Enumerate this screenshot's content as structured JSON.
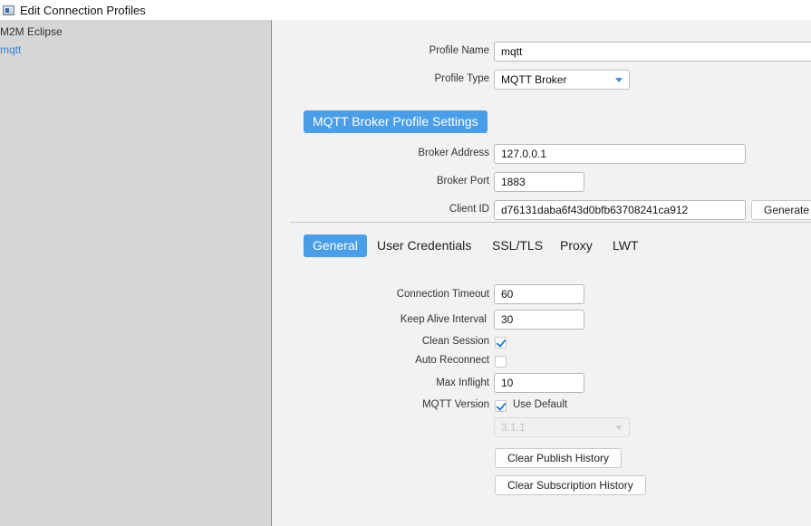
{
  "window": {
    "title": "Edit Connection Profiles"
  },
  "sidebar": {
    "root": "M2M Eclipse",
    "items": [
      {
        "label": "mqtt"
      }
    ]
  },
  "profile": {
    "name_label": "Profile Name",
    "name_value": "mqtt",
    "type_label": "Profile Type",
    "type_value": "MQTT Broker"
  },
  "broker": {
    "section_title": "MQTT Broker Profile Settings",
    "address_label": "Broker Address",
    "address_value": "127.0.0.1",
    "port_label": "Broker Port",
    "port_value": "1883",
    "client_id_label": "Client ID",
    "client_id_value": "d76131daba6f43d0bfb63708241ca912",
    "generate_label": "Generate"
  },
  "tabs": [
    {
      "label": "General",
      "active": true
    },
    {
      "label": "User Credentials",
      "active": false
    },
    {
      "label": "SSL/TLS",
      "active": false
    },
    {
      "label": "Proxy",
      "active": false
    },
    {
      "label": "LWT",
      "active": false
    }
  ],
  "general": {
    "timeout_label": "Connection Timeout",
    "timeout_value": "60",
    "keepalive_label": "Keep Alive Interval",
    "keepalive_value": "30",
    "clean_session_label": "Clean Session",
    "clean_session_checked": true,
    "auto_reconnect_label": "Auto Reconnect",
    "auto_reconnect_checked": false,
    "max_inflight_label": "Max Inflight",
    "max_inflight_value": "10",
    "mqtt_version_label": "MQTT Version",
    "use_default_label": "Use Default",
    "use_default_checked": true,
    "version_value": "3.1.1",
    "clear_publish_label": "Clear Publish History",
    "clear_subscription_label": "Clear Subscription History"
  },
  "colors": {
    "accent": "#4a9ee8",
    "sidebar_bg": "#d6d6d6",
    "panel_bg": "#f2f2f2",
    "link": "#2f86d8"
  }
}
